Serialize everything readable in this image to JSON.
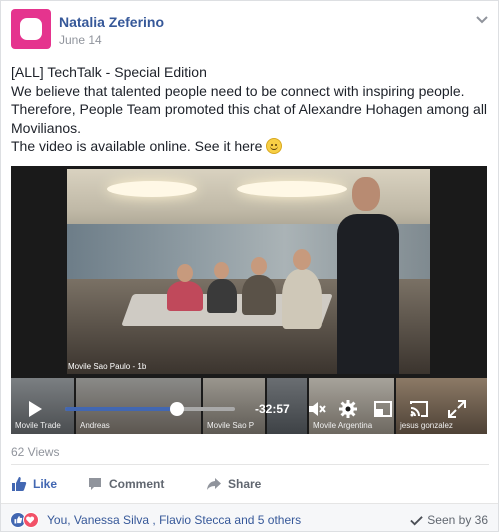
{
  "post": {
    "author": "Natalia Zeferino",
    "date": "June 14",
    "avatar_color": "#e5348e",
    "text_lines": [
      "[ALL] TechTalk - Special Edition",
      "We believe that talented people need to be connect with inspiring people. Therefore, People Team promoted this chat of Alexandre Hohagen among all Movilianos.",
      "The video is available online. See it here"
    ],
    "emoji": "smiley-face"
  },
  "video": {
    "main_label": "Movile Sao Paulo - 1b",
    "thumbnails": [
      "Movile Trade",
      "Andreas",
      "Movile Sao P",
      "",
      "Movile Argentina",
      "jesus gonzalez"
    ],
    "time_remaining": "-32:57",
    "progress": 0.66,
    "icons": [
      "play-icon",
      "mute-icon",
      "settings-icon",
      "fullscreen-icon",
      "cast-icon",
      "expand-icon"
    ]
  },
  "views": "62 Views",
  "actions": {
    "like": "Like",
    "comment": "Comment",
    "share": "Share"
  },
  "footer": {
    "reactors": "You, Vanessa Silva , Flavio Stecca and 5 others",
    "seen": "Seen by 36"
  },
  "colors": {
    "link": "#365899",
    "facebook_blue": "#4267b2",
    "muted": "#90949c"
  }
}
